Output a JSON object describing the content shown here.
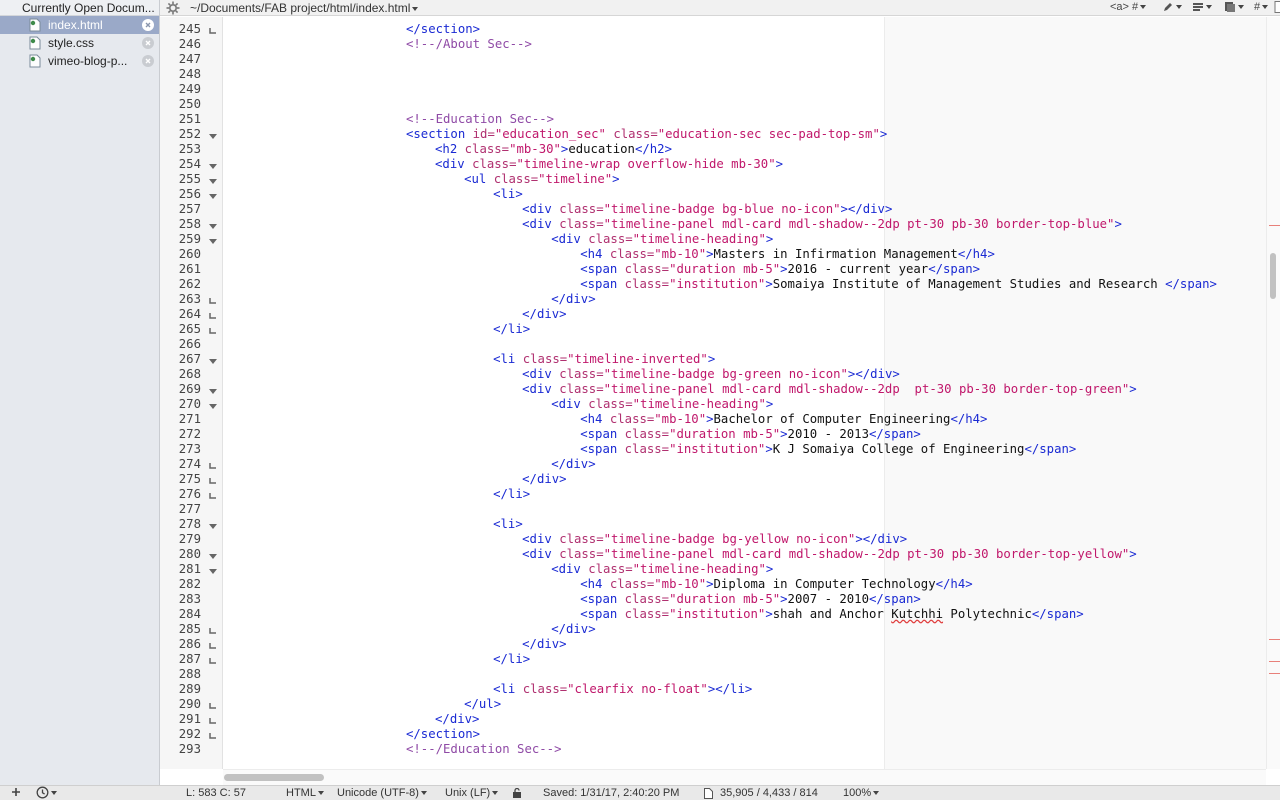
{
  "sidebar": {
    "header": "Currently Open Docum...",
    "documents": [
      {
        "name": "index.html",
        "active": true
      },
      {
        "name": "style.css",
        "active": false
      },
      {
        "name": "vimeo-blog-p...",
        "active": false
      }
    ]
  },
  "pathbar": {
    "path": "~/Documents/FAB project/html/index.html",
    "tag_menu": "<a> #",
    "hash_menu": "#"
  },
  "editor": {
    "lines": [
      {
        "n": "245",
        "fold": "end",
        "indent": 0,
        "tokens": [
          [
            "t",
            "</section>"
          ]
        ]
      },
      {
        "n": "246",
        "fold": "",
        "indent": 0,
        "tokens": [
          [
            "c",
            "<!--/About Sec-->"
          ]
        ]
      },
      {
        "n": "247",
        "fold": "",
        "indent": 0,
        "tokens": []
      },
      {
        "n": "248",
        "fold": "",
        "indent": 0,
        "tokens": []
      },
      {
        "n": "249",
        "fold": "",
        "indent": 0,
        "tokens": []
      },
      {
        "n": "250",
        "fold": "",
        "indent": 0,
        "tokens": []
      },
      {
        "n": "251",
        "fold": "",
        "indent": 0,
        "tokens": [
          [
            "c",
            "<!--Education Sec-->"
          ]
        ]
      },
      {
        "n": "252",
        "fold": "start",
        "indent": 0,
        "tokens": [
          [
            "t",
            "<section "
          ],
          [
            "a",
            "id="
          ],
          [
            "s",
            "\"education_sec\""
          ],
          [
            "a",
            " class="
          ],
          [
            "s",
            "\"education-sec sec-pad-top-sm\""
          ],
          [
            "t",
            ">"
          ]
        ]
      },
      {
        "n": "253",
        "fold": "",
        "indent": 4,
        "tokens": [
          [
            "t",
            "<h2 "
          ],
          [
            "a",
            "class="
          ],
          [
            "s",
            "\"mb-30\""
          ],
          [
            "t",
            ">"
          ],
          [
            "x",
            "education"
          ],
          [
            "t",
            "</h2>"
          ]
        ]
      },
      {
        "n": "254",
        "fold": "start",
        "indent": 4,
        "tokens": [
          [
            "t",
            "<div "
          ],
          [
            "a",
            "class="
          ],
          [
            "s",
            "\"timeline-wrap overflow-hide mb-30\""
          ],
          [
            "t",
            ">"
          ]
        ]
      },
      {
        "n": "255",
        "fold": "start",
        "indent": 8,
        "tokens": [
          [
            "t",
            "<ul "
          ],
          [
            "a",
            "class="
          ],
          [
            "s",
            "\"timeline\""
          ],
          [
            "t",
            ">"
          ]
        ]
      },
      {
        "n": "256",
        "fold": "start",
        "indent": 12,
        "tokens": [
          [
            "t",
            "<li>"
          ]
        ]
      },
      {
        "n": "257",
        "fold": "",
        "indent": 16,
        "tokens": [
          [
            "t",
            "<div "
          ],
          [
            "a",
            "class="
          ],
          [
            "s",
            "\"timeline-badge bg-blue no-icon\""
          ],
          [
            "t",
            "></div>"
          ]
        ]
      },
      {
        "n": "258",
        "fold": "start",
        "indent": 16,
        "tokens": [
          [
            "t",
            "<div "
          ],
          [
            "a",
            "class="
          ],
          [
            "s",
            "\"timeline-panel mdl-card mdl-shadow--2dp pt-30 pb-30 border-top-blue\""
          ],
          [
            "t",
            ">"
          ]
        ]
      },
      {
        "n": "259",
        "fold": "start",
        "indent": 20,
        "tokens": [
          [
            "t",
            "<div "
          ],
          [
            "a",
            "class="
          ],
          [
            "s",
            "\"timeline-heading\""
          ],
          [
            "t",
            ">"
          ]
        ]
      },
      {
        "n": "260",
        "fold": "",
        "indent": 24,
        "tokens": [
          [
            "t",
            "<h4 "
          ],
          [
            "a",
            "class="
          ],
          [
            "s",
            "\"mb-10\""
          ],
          [
            "t",
            ">"
          ],
          [
            "x",
            "Masters in Infirmation Management"
          ],
          [
            "t",
            "</h4>"
          ]
        ]
      },
      {
        "n": "261",
        "fold": "",
        "indent": 24,
        "tokens": [
          [
            "t",
            "<span "
          ],
          [
            "a",
            "class="
          ],
          [
            "s",
            "\"duration mb-5\""
          ],
          [
            "t",
            ">"
          ],
          [
            "x",
            "2016 - current year"
          ],
          [
            "t",
            "</span>"
          ]
        ]
      },
      {
        "n": "262",
        "fold": "",
        "indent": 24,
        "tokens": [
          [
            "t",
            "<span "
          ],
          [
            "a",
            "class="
          ],
          [
            "s",
            "\"institution\""
          ],
          [
            "t",
            ">"
          ],
          [
            "x",
            "Somaiya Institute of Management Studies and Research "
          ],
          [
            "t",
            "</span>"
          ]
        ]
      },
      {
        "n": "263",
        "fold": "end",
        "indent": 20,
        "tokens": [
          [
            "t",
            "</div>"
          ]
        ]
      },
      {
        "n": "264",
        "fold": "end",
        "indent": 16,
        "tokens": [
          [
            "t",
            "</div>"
          ]
        ]
      },
      {
        "n": "265",
        "fold": "end",
        "indent": 12,
        "tokens": [
          [
            "t",
            "</li>"
          ]
        ]
      },
      {
        "n": "266",
        "fold": "",
        "indent": 0,
        "tokens": []
      },
      {
        "n": "267",
        "fold": "start",
        "indent": 12,
        "tokens": [
          [
            "t",
            "<li "
          ],
          [
            "a",
            "class="
          ],
          [
            "s",
            "\"timeline-inverted\""
          ],
          [
            "t",
            ">"
          ]
        ]
      },
      {
        "n": "268",
        "fold": "",
        "indent": 16,
        "tokens": [
          [
            "t",
            "<div "
          ],
          [
            "a",
            "class="
          ],
          [
            "s",
            "\"timeline-badge bg-green no-icon\""
          ],
          [
            "t",
            "></div>"
          ]
        ]
      },
      {
        "n": "269",
        "fold": "start",
        "indent": 16,
        "tokens": [
          [
            "t",
            "<div "
          ],
          [
            "a",
            "class="
          ],
          [
            "s",
            "\"timeline-panel mdl-card mdl-shadow--2dp  pt-30 pb-30 border-top-green\""
          ],
          [
            "t",
            ">"
          ]
        ]
      },
      {
        "n": "270",
        "fold": "start",
        "indent": 20,
        "tokens": [
          [
            "t",
            "<div "
          ],
          [
            "a",
            "class="
          ],
          [
            "s",
            "\"timeline-heading\""
          ],
          [
            "t",
            ">"
          ]
        ]
      },
      {
        "n": "271",
        "fold": "",
        "indent": 24,
        "tokens": [
          [
            "t",
            "<h4 "
          ],
          [
            "a",
            "class="
          ],
          [
            "s",
            "\"mb-10\""
          ],
          [
            "t",
            ">"
          ],
          [
            "x",
            "Bachelor of Computer Engineering"
          ],
          [
            "t",
            "</h4>"
          ]
        ]
      },
      {
        "n": "272",
        "fold": "",
        "indent": 24,
        "tokens": [
          [
            "t",
            "<span "
          ],
          [
            "a",
            "class="
          ],
          [
            "s",
            "\"duration mb-5\""
          ],
          [
            "t",
            ">"
          ],
          [
            "x",
            "2010 - 2013"
          ],
          [
            "t",
            "</span>"
          ]
        ]
      },
      {
        "n": "273",
        "fold": "",
        "indent": 24,
        "tokens": [
          [
            "t",
            "<span "
          ],
          [
            "a",
            "class="
          ],
          [
            "s",
            "\"institution\""
          ],
          [
            "t",
            ">"
          ],
          [
            "x",
            "K J Somaiya College of Engineering"
          ],
          [
            "t",
            "</span>"
          ]
        ]
      },
      {
        "n": "274",
        "fold": "end",
        "indent": 20,
        "tokens": [
          [
            "t",
            "</div>"
          ]
        ]
      },
      {
        "n": "275",
        "fold": "end",
        "indent": 16,
        "tokens": [
          [
            "t",
            "</div>"
          ]
        ]
      },
      {
        "n": "276",
        "fold": "end",
        "indent": 12,
        "tokens": [
          [
            "t",
            "</li>"
          ]
        ]
      },
      {
        "n": "277",
        "fold": "",
        "indent": 0,
        "tokens": []
      },
      {
        "n": "278",
        "fold": "start",
        "indent": 12,
        "tokens": [
          [
            "t",
            "<li>"
          ]
        ]
      },
      {
        "n": "279",
        "fold": "",
        "indent": 16,
        "tokens": [
          [
            "t",
            "<div "
          ],
          [
            "a",
            "class="
          ],
          [
            "s",
            "\"timeline-badge bg-yellow no-icon\""
          ],
          [
            "t",
            "></div>"
          ]
        ]
      },
      {
        "n": "280",
        "fold": "start",
        "indent": 16,
        "tokens": [
          [
            "t",
            "<div "
          ],
          [
            "a",
            "class="
          ],
          [
            "s",
            "\"timeline-panel mdl-card mdl-shadow--2dp pt-30 pb-30 border-top-yellow\""
          ],
          [
            "t",
            ">"
          ]
        ]
      },
      {
        "n": "281",
        "fold": "start",
        "indent": 20,
        "tokens": [
          [
            "t",
            "<div "
          ],
          [
            "a",
            "class="
          ],
          [
            "s",
            "\"timeline-heading\""
          ],
          [
            "t",
            ">"
          ]
        ]
      },
      {
        "n": "282",
        "fold": "",
        "indent": 24,
        "tokens": [
          [
            "t",
            "<h4 "
          ],
          [
            "a",
            "class="
          ],
          [
            "s",
            "\"mb-10\""
          ],
          [
            "t",
            ">"
          ],
          [
            "x",
            "Diploma in Computer Technology"
          ],
          [
            "t",
            "</h4>"
          ]
        ]
      },
      {
        "n": "283",
        "fold": "",
        "indent": 24,
        "tokens": [
          [
            "t",
            "<span "
          ],
          [
            "a",
            "class="
          ],
          [
            "s",
            "\"duration mb-5\""
          ],
          [
            "t",
            ">"
          ],
          [
            "x",
            "2007 - 2010"
          ],
          [
            "t",
            "</span>"
          ]
        ]
      },
      {
        "n": "284",
        "fold": "",
        "indent": 24,
        "tokens": [
          [
            "t",
            "<span "
          ],
          [
            "a",
            "class="
          ],
          [
            "s",
            "\"institution\""
          ],
          [
            "t",
            ">"
          ],
          [
            "x",
            "shah and Anchor "
          ],
          [
            "q",
            "Kutchhi"
          ],
          [
            "x",
            " Polytechnic"
          ],
          [
            "t",
            "</span>"
          ]
        ]
      },
      {
        "n": "285",
        "fold": "end",
        "indent": 20,
        "tokens": [
          [
            "t",
            "</div>"
          ]
        ]
      },
      {
        "n": "286",
        "fold": "end",
        "indent": 16,
        "tokens": [
          [
            "t",
            "</div>"
          ]
        ]
      },
      {
        "n": "287",
        "fold": "end",
        "indent": 12,
        "tokens": [
          [
            "t",
            "</li>"
          ]
        ]
      },
      {
        "n": "288",
        "fold": "",
        "indent": 0,
        "tokens": []
      },
      {
        "n": "289",
        "fold": "",
        "indent": 12,
        "tokens": [
          [
            "t",
            "<li "
          ],
          [
            "a",
            "class="
          ],
          [
            "s",
            "\"clearfix no-float\""
          ],
          [
            "t",
            "></li>"
          ]
        ]
      },
      {
        "n": "290",
        "fold": "end",
        "indent": 8,
        "tokens": [
          [
            "t",
            "</ul>"
          ]
        ]
      },
      {
        "n": "291",
        "fold": "end",
        "indent": 4,
        "tokens": [
          [
            "t",
            "</div>"
          ]
        ]
      },
      {
        "n": "292",
        "fold": "end",
        "indent": 0,
        "tokens": [
          [
            "t",
            "</section>"
          ]
        ]
      },
      {
        "n": "293",
        "fold": "",
        "indent": 0,
        "tokens": [
          [
            "c",
            "<!--/Education Sec-->"
          ]
        ]
      }
    ]
  },
  "statusbar": {
    "position": "L: 583 C: 57",
    "language": "HTML",
    "encoding": "Unicode (UTF-8)",
    "line_endings": "Unix (LF)",
    "saved": "Saved: 1/31/17, 2:40:20 PM",
    "stats": "35,905 / 4,433 / 814",
    "zoom": "100%"
  },
  "colors": {
    "tag": "#1a2ad3",
    "attribute": "#b03070",
    "string": "#c0176b",
    "comment": "#8f4aa6",
    "text": "#111111",
    "selection": "#9aa9c8"
  }
}
